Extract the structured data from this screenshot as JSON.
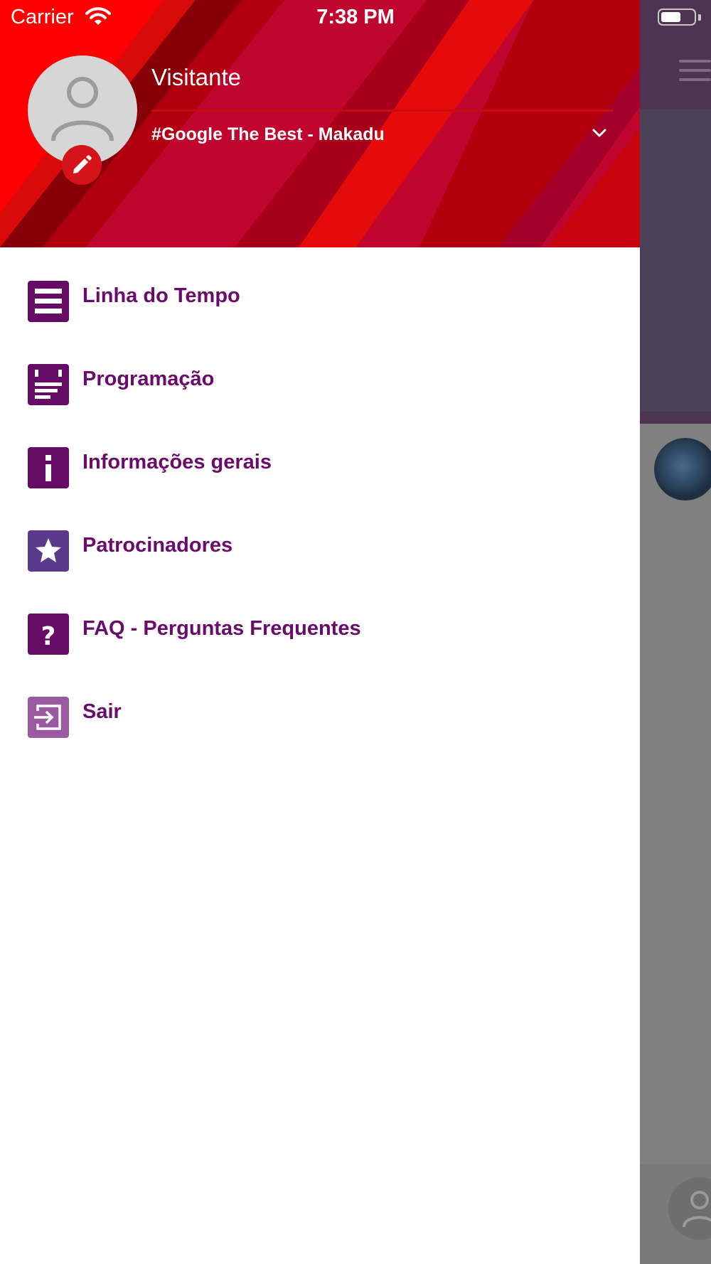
{
  "status_bar": {
    "carrier": "Carrier",
    "time": "7:38 PM",
    "battery_level": 0.62
  },
  "profile": {
    "name": "Visitante",
    "event": "#Google The Best - Makadu"
  },
  "menu": [
    {
      "label": "Linha do Tempo",
      "icon": "timeline-icon",
      "color": "#650A65"
    },
    {
      "label": "Programação",
      "icon": "schedule-icon",
      "color": "#650A65"
    },
    {
      "label": "Informações gerais",
      "icon": "info-icon",
      "color": "#650A65"
    },
    {
      "label": "Patrocinadores",
      "icon": "star-icon",
      "color": "#5B3A8E"
    },
    {
      "label": "FAQ - Perguntas Frequentes",
      "icon": "question-icon",
      "color": "#650A65"
    },
    {
      "label": "Sair",
      "icon": "logout-icon",
      "color": "#9A5AA0"
    }
  ],
  "colors": {
    "accent_red": "#D4141A",
    "menu_text": "#6A0A6A",
    "header_crimson": "#C0062F"
  }
}
